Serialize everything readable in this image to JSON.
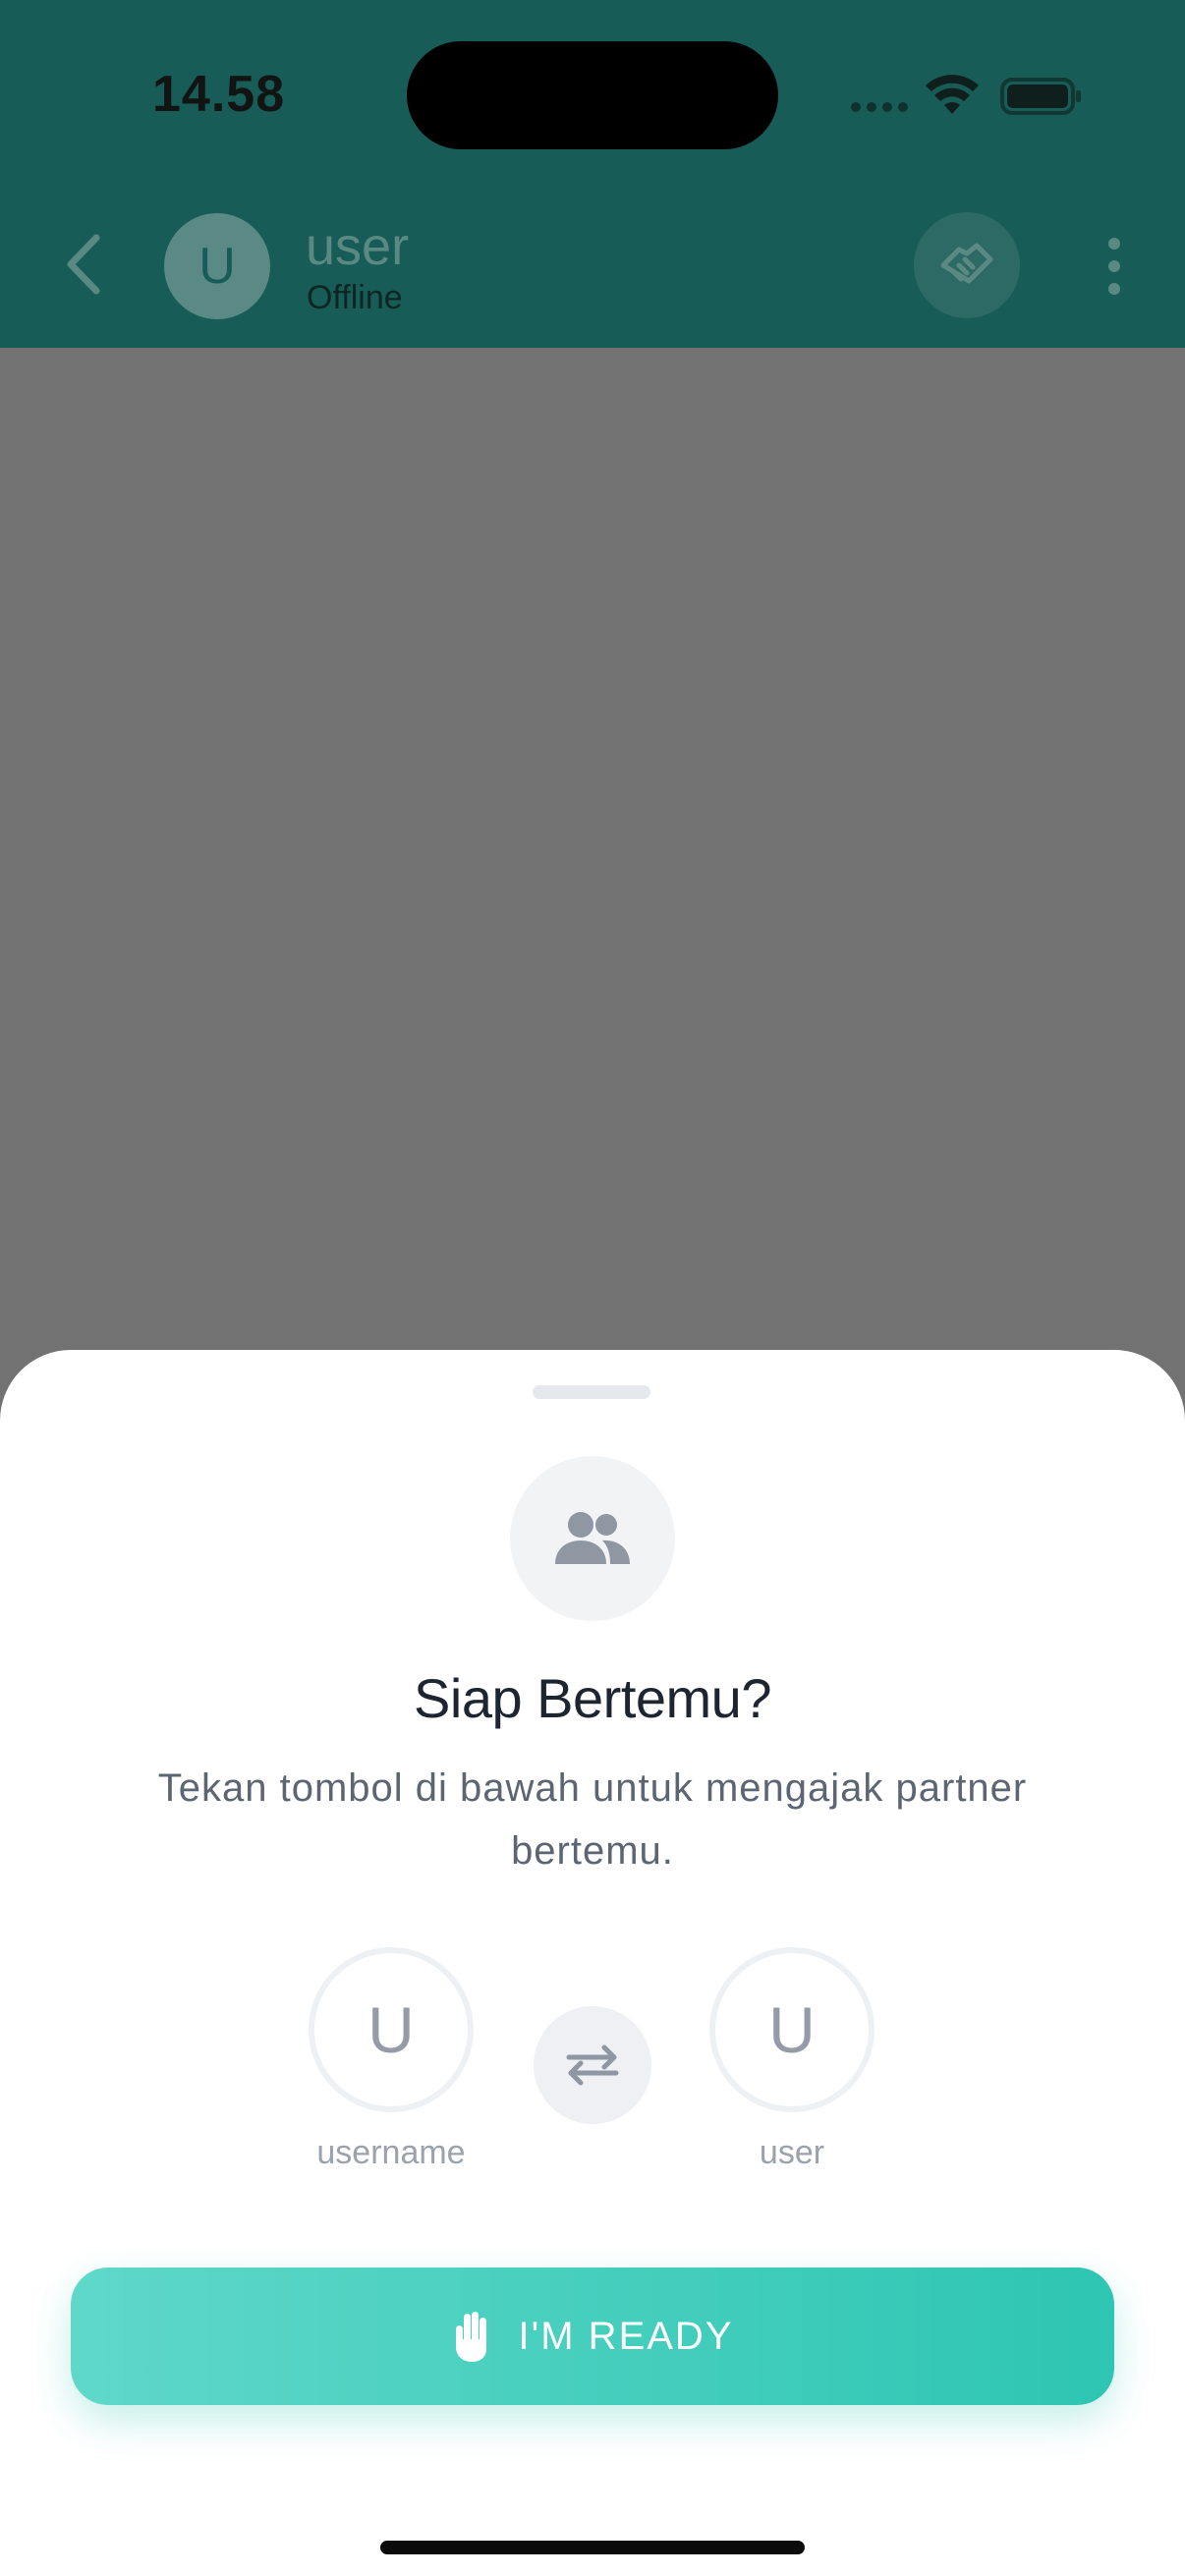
{
  "status_bar": {
    "time": "14.58"
  },
  "header": {
    "avatar_initial": "U",
    "name": "user",
    "status": "Offline",
    "icons": {
      "back": "chevron-left-icon",
      "meet": "handshake-icon",
      "more": "more-vertical-icon"
    }
  },
  "sheet": {
    "title": "Siap Bertemu?",
    "description": "Tekan tombol di bawah untuk mengajak partner bertemu.",
    "participants": [
      {
        "initial": "U",
        "name": "username"
      },
      {
        "initial": "U",
        "name": "user"
      }
    ],
    "icons": {
      "badge": "people-icon",
      "swap": "swap-arrows-icon",
      "ready": "hand-icon"
    },
    "ready_button_label": "I'M READY"
  },
  "colors": {
    "header_bg": "#175c57",
    "overlay": "#727273",
    "accent_start": "#5fd8c8",
    "accent_end": "#2ec5b3",
    "title": "#1c2530",
    "text_muted": "#5c6673"
  }
}
